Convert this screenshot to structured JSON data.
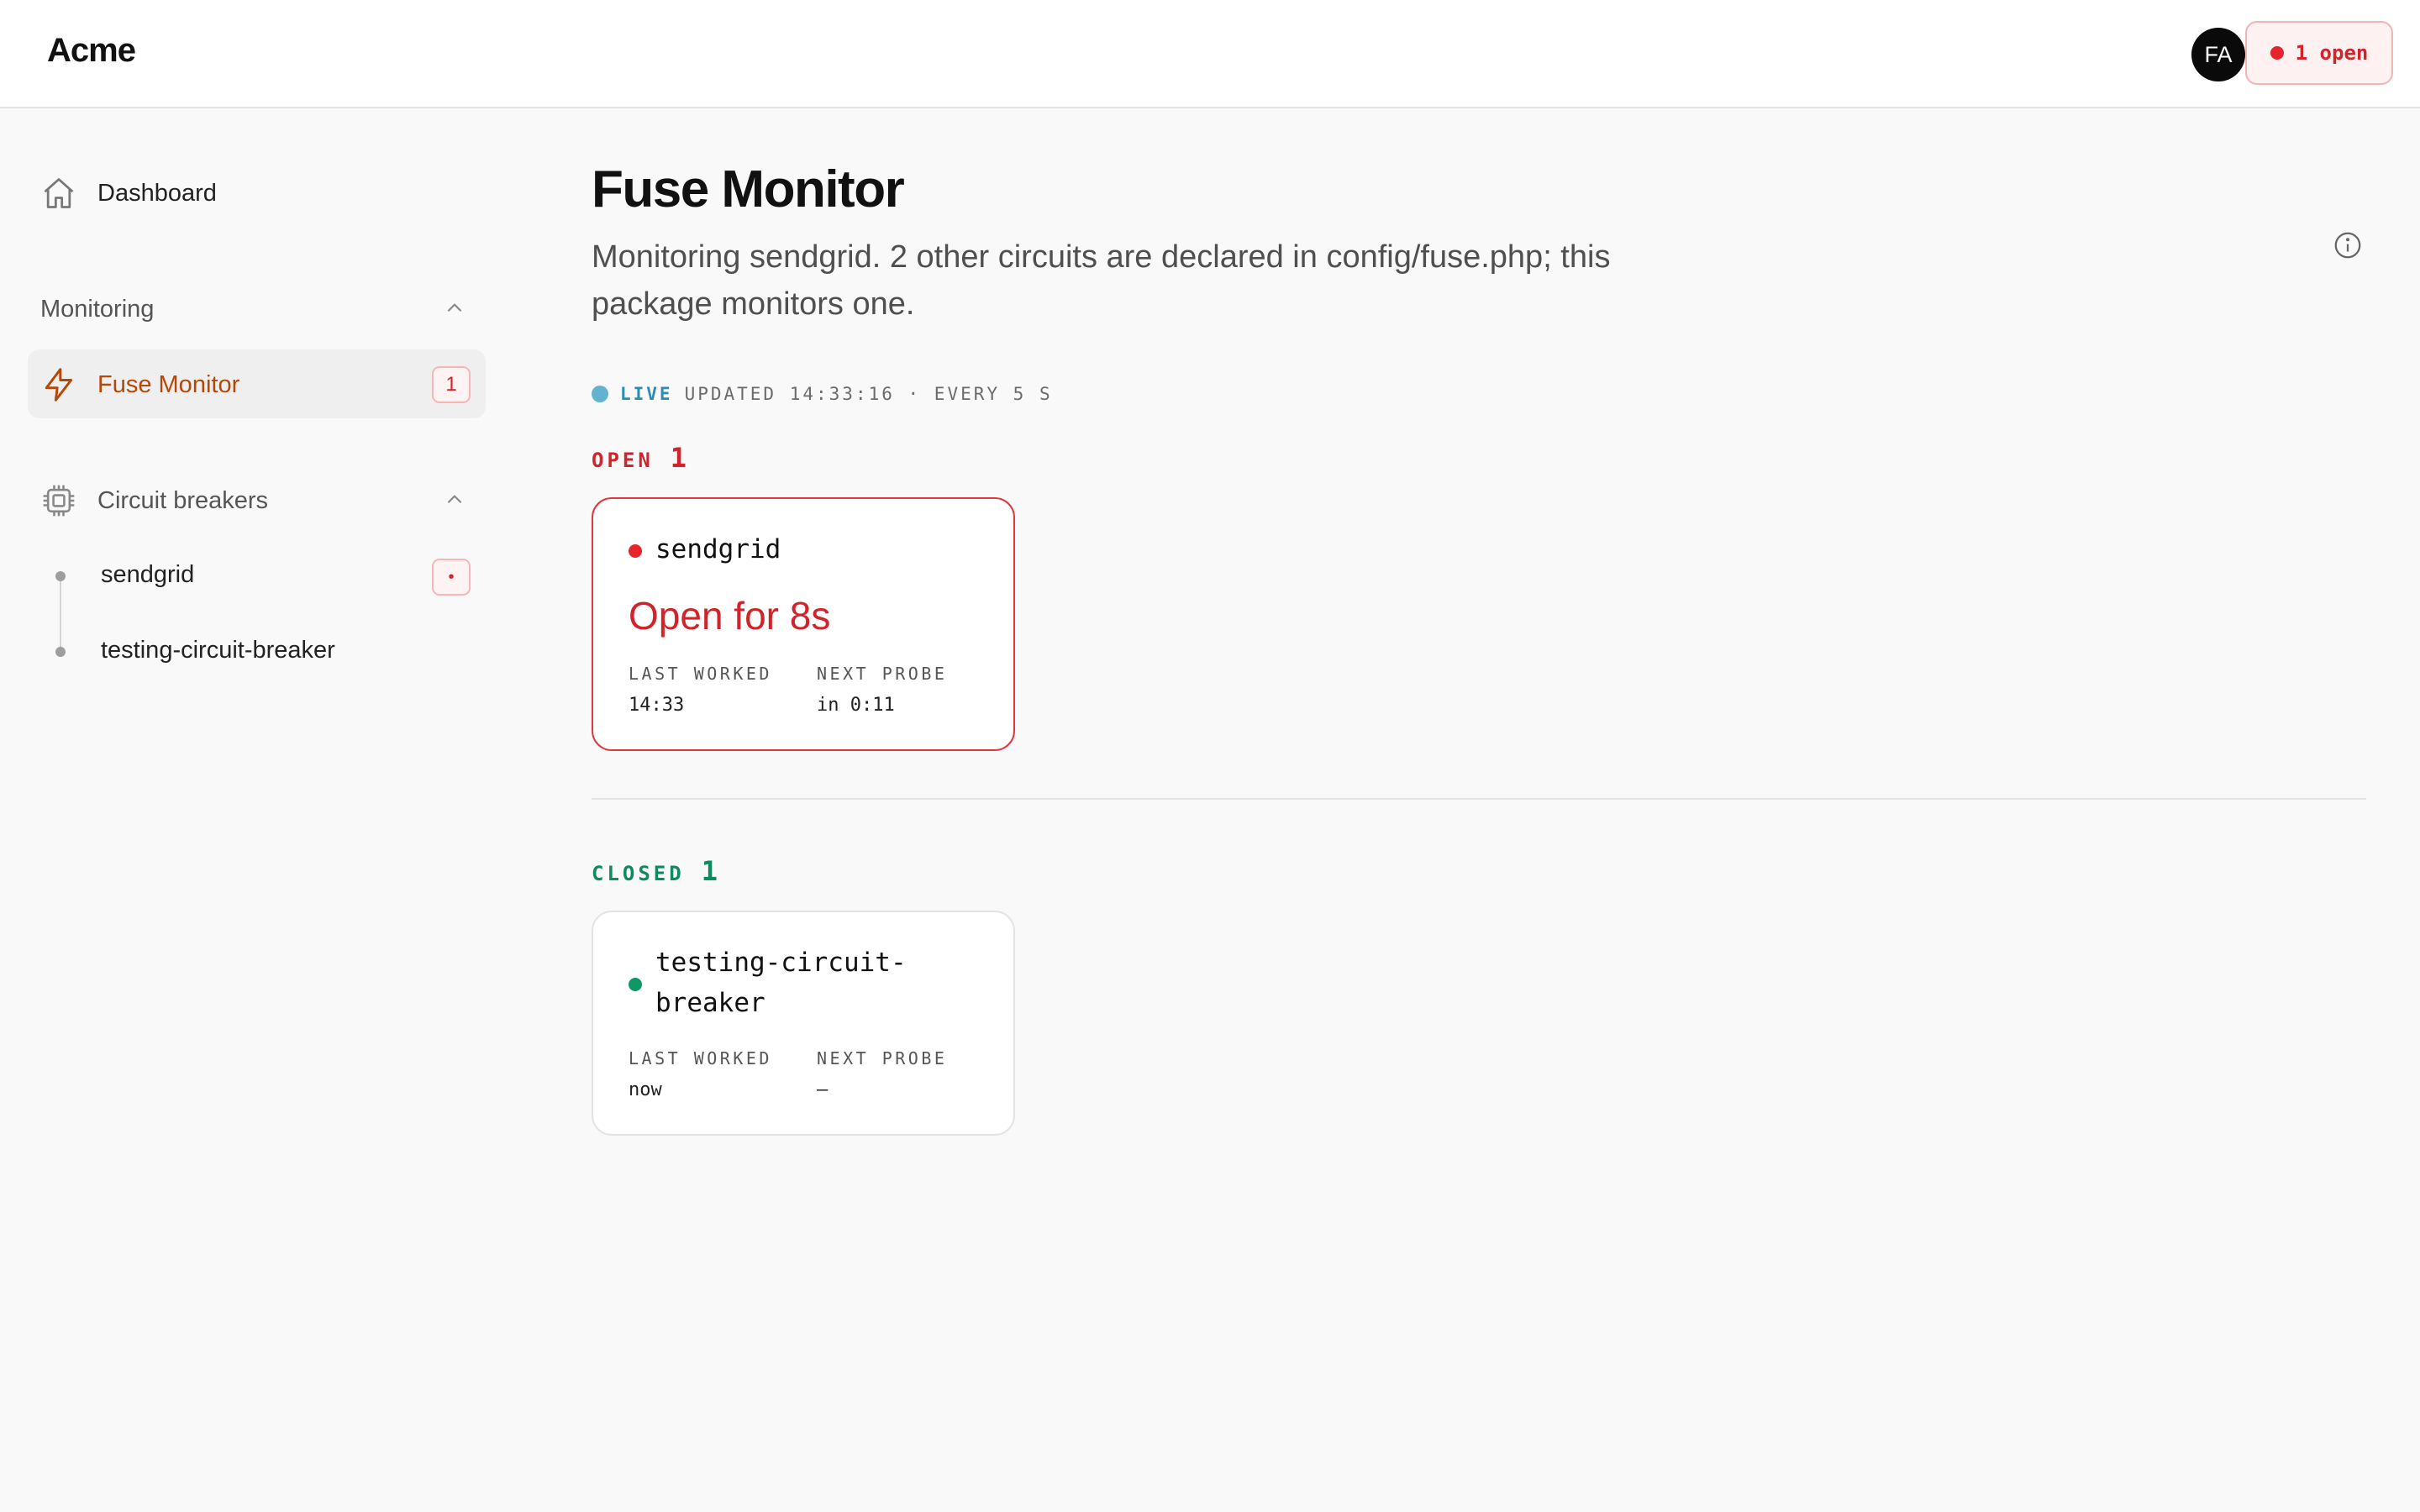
{
  "app": {
    "brand": "Acme"
  },
  "header": {
    "avatar_initials": "FA",
    "open_pill": "1 open"
  },
  "sidebar": {
    "dashboard": {
      "label": "Dashboard",
      "icon": "home-icon"
    },
    "monitoring": {
      "title": "Monitoring",
      "items": [
        {
          "label": "Fuse Monitor",
          "icon": "lightning-icon",
          "badge": "1"
        }
      ]
    },
    "circuit_breakers": {
      "title": "Circuit breakers",
      "icon": "chip-icon",
      "items": [
        {
          "label": "sendgrid",
          "badge": "•"
        },
        {
          "label": "testing-circuit-breaker"
        }
      ]
    }
  },
  "main": {
    "title": "Fuse Monitor",
    "subtitle": "Monitoring sendgrid. 2 other circuits are declared in config/fuse.php; this package monitors one.",
    "live": {
      "label": "LIVE",
      "meta": "UPDATED 14:33:16 · EVERY 5 S"
    },
    "open_group": {
      "label": "OPEN",
      "count": "1",
      "cards": [
        {
          "name": "sendgrid",
          "status": "Open for 8s",
          "last_worked_label": "LAST WORKED",
          "last_worked": "14:33",
          "next_probe_label": "NEXT PROBE",
          "next_probe": "in 0:11"
        }
      ]
    },
    "closed_group": {
      "label": "CLOSED",
      "count": "1",
      "cards": [
        {
          "name_line1": "testing-circuit-",
          "name_line2": "breaker",
          "last_worked_label": "LAST WORKED",
          "last_worked": "now",
          "next_probe_label": "NEXT PROBE",
          "next_probe": "—"
        }
      ]
    }
  },
  "colors": {
    "open_red": "#d1242a",
    "closed_green": "#0d8a5f",
    "live_blue": "#2a8fae",
    "accent_orange": "#b54708"
  }
}
